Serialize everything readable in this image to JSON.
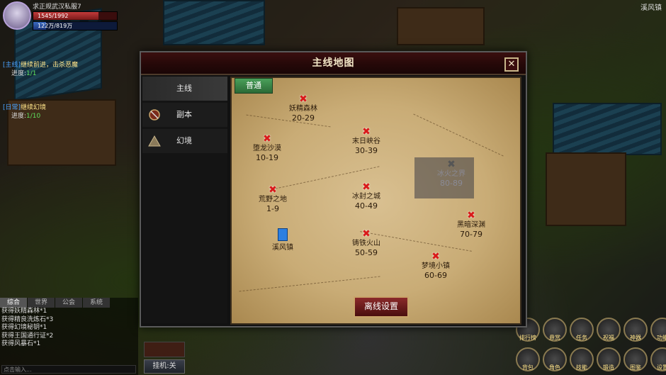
{
  "hud": {
    "player_name": "求正规武汉私服7",
    "hp_text": "1545/1992",
    "hp_pct": 0.776,
    "mp_text": "122万/819万",
    "mp_pct": 0.15,
    "town": "溪风镇"
  },
  "quests": [
    {
      "tag": "[主线]",
      "text": "继续前进，击杀恶魔",
      "progress_label": "进度:",
      "progress": "1/1"
    },
    {
      "tag": "[日常]",
      "text": "继续幻境",
      "progress_label": "进度:",
      "progress": "1/10"
    }
  ],
  "chat": {
    "tabs": [
      "综合",
      "世界",
      "公会",
      "系统"
    ],
    "lines": [
      "获得妖精森林*1",
      "获得精良洗炼石*3",
      "获得幻境秘钥*1",
      "获得王国通行证*2",
      "获得风暴石*1"
    ],
    "input_placeholder": "点击输入..."
  },
  "hang_button": "挂机:关",
  "dialog": {
    "title": "主线地图",
    "close_symbol": "✕",
    "sidebar": [
      {
        "label": "主线",
        "icon": "none",
        "active": true
      },
      {
        "label": "副本",
        "icon": "shield-icon",
        "active": false
      },
      {
        "label": "幻境",
        "icon": "pyramid-icon",
        "active": false
      }
    ],
    "mode_tab": "普通",
    "offline_button": "离线设置",
    "locations": [
      {
        "name": "妖精森林",
        "level": "20-29",
        "state": "cleared"
      },
      {
        "name": "末日峡谷",
        "level": "30-39",
        "state": "cleared"
      },
      {
        "name": "堕龙沙漠",
        "level": "10-19",
        "state": "cleared"
      },
      {
        "name": "冰火之界",
        "level": "80-89",
        "state": "locked"
      },
      {
        "name": "荒野之地",
        "level": "1-9",
        "state": "cleared"
      },
      {
        "name": "冰封之城",
        "level": "40-49",
        "state": "cleared"
      },
      {
        "name": "黑暗深渊",
        "level": "70-79",
        "state": "cleared"
      },
      {
        "name": "溪风镇",
        "level": "",
        "state": "current"
      },
      {
        "name": "铸铁火山",
        "level": "50-59",
        "state": "cleared"
      },
      {
        "name": "梦境小镇",
        "level": "60-69",
        "state": "cleared"
      }
    ]
  },
  "bottom_icons": [
    "排行榜",
    "悬赏",
    "任务",
    "祝福",
    "神器",
    "功能",
    "背包",
    "角色",
    "技能",
    "锻造",
    "图鉴",
    "设置"
  ]
}
